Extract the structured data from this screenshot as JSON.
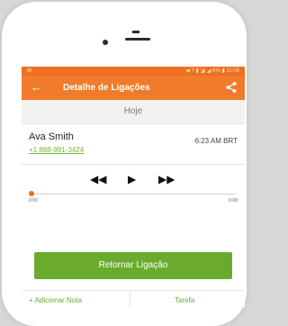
{
  "status_bar": {
    "left_glyph": "⊠",
    "right_text": "◀ ? ▮ ◪ ◢ 6% ▮ 11:06"
  },
  "app_bar": {
    "back_icon": "←",
    "title": "Detalhe de Ligações",
    "share_icon": "share-icon"
  },
  "date_header": "Hoje",
  "contact": {
    "name": "Ava Smith",
    "phone": "+1 888-991-3424",
    "time": "6:23 AM BRT"
  },
  "player": {
    "rewind": "◀◀",
    "play": "▶",
    "forward": "▶▶",
    "current_time": "0:00",
    "duration": "0:08",
    "progress": 0
  },
  "actions": {
    "callback": "Retornar Ligação",
    "add_note_partial": "+ Adicionar Nota",
    "right_partial": "Tarefa"
  },
  "colors": {
    "accent": "#f07b2a",
    "green": "#6aab2e"
  }
}
